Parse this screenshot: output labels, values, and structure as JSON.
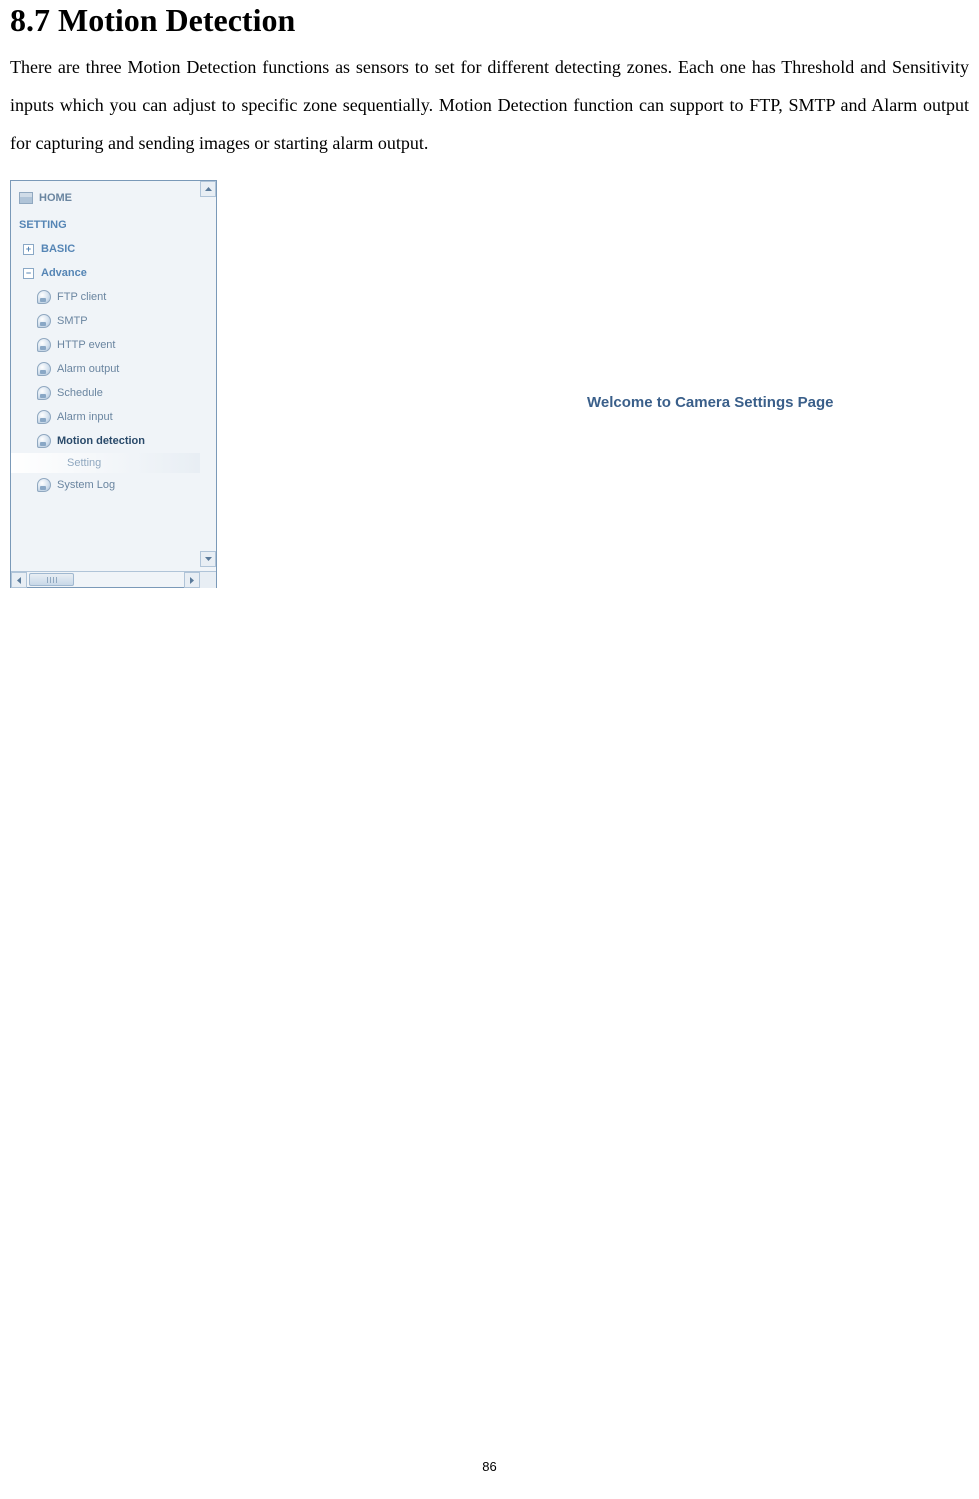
{
  "heading": "8.7 Motion Detection",
  "paragraph": "There are three Motion Detection functions as sensors to set for different detecting zones. Each one has Threshold and Sensitivity inputs which you can adjust to specific zone sequentially. Motion Detection function can support to FTP, SMTP and Alarm output for capturing and sending images or starting alarm output.",
  "nav": {
    "home": "HOME",
    "setting": "SETTING",
    "basic": "BASIC",
    "advance": "Advance",
    "items": {
      "ftp": "FTP client",
      "smtp": "SMTP",
      "http": "HTTP event",
      "alarmout": "Alarm output",
      "schedule": "Schedule",
      "alarmin": "Alarm input",
      "motion": "Motion detection",
      "setting_sub": "Setting",
      "syslog": "System Log"
    }
  },
  "welcome": "Welcome to Camera Settings Page",
  "pagenum": "86"
}
